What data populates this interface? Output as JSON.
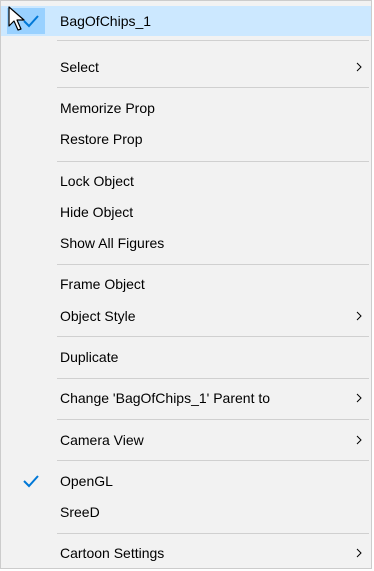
{
  "menu": {
    "items": [
      {
        "label": "BagOfChips_1"
      },
      {
        "label": "Select"
      },
      {
        "label": "Memorize Prop"
      },
      {
        "label": "Restore Prop"
      },
      {
        "label": "Lock Object"
      },
      {
        "label": "Hide Object"
      },
      {
        "label": "Show All Figures"
      },
      {
        "label": "Frame Object"
      },
      {
        "label": "Object Style"
      },
      {
        "label": "Duplicate"
      },
      {
        "label": "Change 'BagOfChips_1' Parent to"
      },
      {
        "label": "Camera View"
      },
      {
        "label": "OpenGL"
      },
      {
        "label": "SreeD"
      },
      {
        "label": "Cartoon Settings"
      }
    ]
  },
  "colors": {
    "menu_bg": "#f2f2f2",
    "highlight": "#cce8ff",
    "check_bg": "#99d1ff",
    "check_mark": "#0078d7",
    "separator": "#d0d0d0"
  },
  "icons": {
    "submenu": "chevron-right-icon",
    "checked": "checkmark-icon",
    "pointer": "mouse-cursor-icon"
  }
}
